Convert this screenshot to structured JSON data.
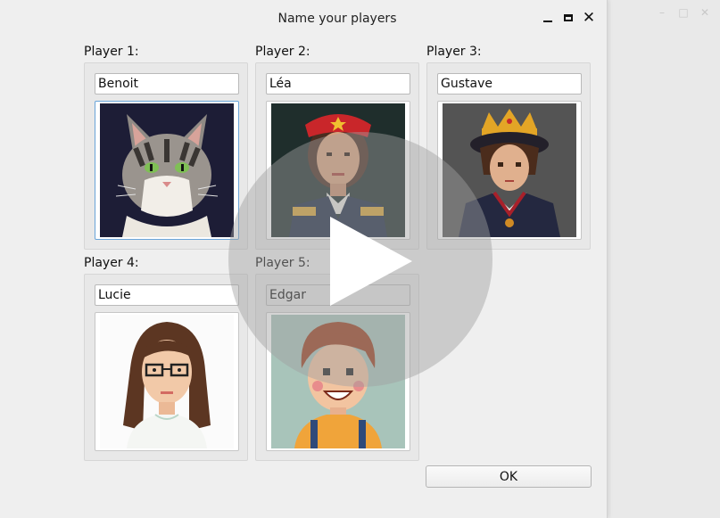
{
  "dialog": {
    "title": "Name your players",
    "ok_label": "OK"
  },
  "players": [
    {
      "label": "Player 1:",
      "name": "Benoit",
      "avatar": "cat-avatar"
    },
    {
      "label": "Player 2:",
      "name": "Léa",
      "avatar": "woman-red-beret-avatar"
    },
    {
      "label": "Player 3:",
      "name": "Gustave",
      "avatar": "prince-crown-avatar"
    },
    {
      "label": "Player 4:",
      "name": "Lucie",
      "avatar": "woman-glasses-avatar"
    },
    {
      "label": "Player 5:",
      "name": "Edgar",
      "avatar": "boy-smiling-avatar"
    }
  ],
  "icons": {
    "minimize": "minimize-icon",
    "maximize": "maximize-icon",
    "close": "close-icon",
    "play": "play-icon"
  }
}
